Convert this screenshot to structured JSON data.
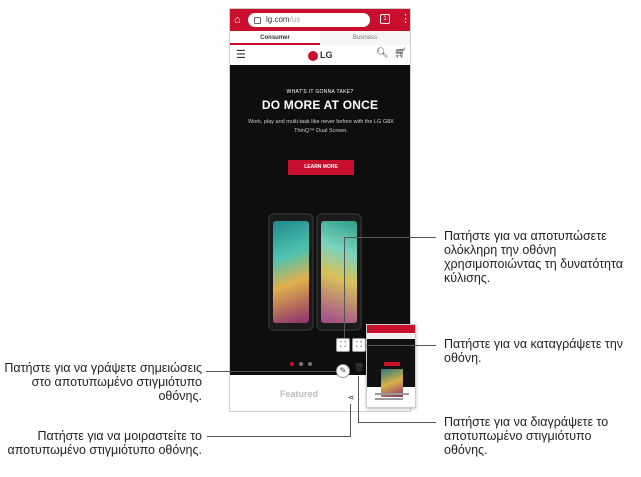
{
  "browser": {
    "url_domain": "lg.com",
    "url_path": "/us",
    "tab_count": "1"
  },
  "site_tabs": [
    "Consumer",
    "Business"
  ],
  "header": {
    "logo_text": "LG"
  },
  "hero": {
    "eyebrow": "WHAT'S IT GONNA TAKE?",
    "headline": "DO MORE AT ONCE",
    "subtext": "Work, play and multi-task like never before with the LG G8X ThinQ™ Dual Screen.",
    "cta_label": "LEARN MORE"
  },
  "featured_label": "Featured",
  "callouts": {
    "scroll_capture": "Πατήστε για να αποτυπώσετε ολόκληρη την οθόνη χρησιμοποιώντας τη δυνατότητα κύλισης.",
    "record_screen": "Πατήστε για να καταγράψετε την οθόνη.",
    "write_notes": "Πατήστε για να γράψετε σημειώσεις στο αποτυπωμένο στιγμιότυπο οθόνης.",
    "share": "Πατήστε για να μοιραστείτε το αποτυπωμένο στιγμιότυπο οθόνης.",
    "delete": "Πατήστε για να διαγράψετε το αποτυπωμένο στιγμιότυπο οθόνης."
  },
  "colors": {
    "brand_red": "#c8102e"
  },
  "icons": [
    "home-icon",
    "lock-icon",
    "tabs-icon",
    "more-icon",
    "menu-icon",
    "search-icon",
    "cart-icon",
    "scroll-capture-icon",
    "screen-record-icon",
    "edit-icon",
    "delete-icon",
    "share-icon"
  ]
}
